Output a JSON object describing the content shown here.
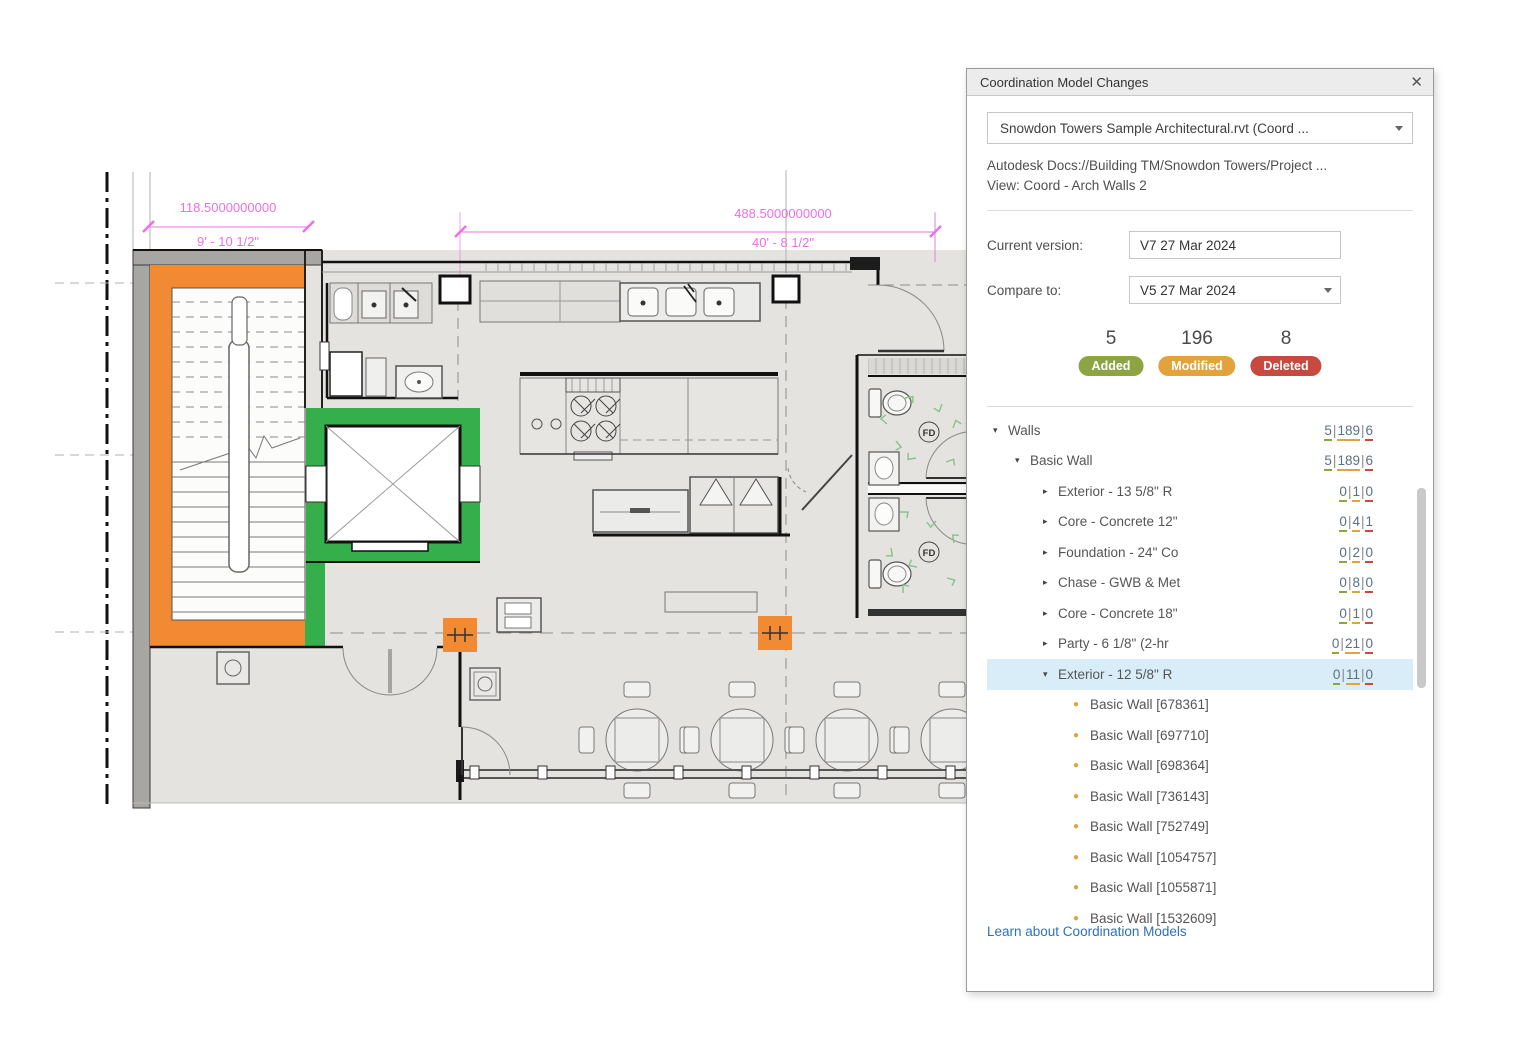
{
  "plan": {
    "dim1_top": "118.5000000000",
    "dim1_bottom": "9' - 10 1/2\"",
    "dim2_top": "488.5000000000",
    "dim2_bottom": "40' - 8 1/2\"",
    "fd_label": "FD",
    "colors": {
      "added_highlight": "#35AF4B",
      "modified_highlight": "#F18A33",
      "dimension_pink": "#ED6FE8"
    }
  },
  "panel": {
    "title": "Coordination Model Changes",
    "close_icon": "✕",
    "model_dropdown_value": "Snowdon Towers Sample Architectural.rvt (Coord ...",
    "source_line1": "Autodesk Docs://Building TM/Snowdon Towers/Project ...",
    "source_line2": "View: Coord - Arch Walls 2",
    "current_version_label": "Current version:",
    "current_version_value": "V7 27 Mar 2024",
    "compare_to_label": "Compare to:",
    "compare_to_value": "V5 27 Mar 2024",
    "stats": [
      {
        "count": "5",
        "label": "Added"
      },
      {
        "count": "196",
        "label": "Modified"
      },
      {
        "count": "8",
        "label": "Deleted"
      }
    ],
    "tree": [
      {
        "level": 1,
        "expanded": true,
        "selected": false,
        "label": "Walls",
        "counts": [
          "5",
          "189",
          "6"
        ]
      },
      {
        "level": 2,
        "expanded": true,
        "selected": false,
        "label": "Basic Wall",
        "counts": [
          "5",
          "189",
          "6"
        ]
      },
      {
        "level": 3,
        "expanded": false,
        "selected": false,
        "label": "Exterior - 13 5/8\" R",
        "counts": [
          "0",
          "1",
          "0"
        ]
      },
      {
        "level": 3,
        "expanded": false,
        "selected": false,
        "label": "Core - Concrete 12\"",
        "counts": [
          "0",
          "4",
          "1"
        ]
      },
      {
        "level": 3,
        "expanded": false,
        "selected": false,
        "label": "Foundation - 24\" Co",
        "counts": [
          "0",
          "2",
          "0"
        ]
      },
      {
        "level": 3,
        "expanded": false,
        "selected": false,
        "label": "Chase - GWB & Met",
        "counts": [
          "0",
          "8",
          "0"
        ]
      },
      {
        "level": 3,
        "expanded": false,
        "selected": false,
        "label": "Core - Concrete 18\"",
        "counts": [
          "0",
          "1",
          "0"
        ]
      },
      {
        "level": 3,
        "expanded": false,
        "selected": false,
        "label": "Party - 6 1/8\" (2-hr",
        "counts": [
          "0",
          "21",
          "0"
        ]
      },
      {
        "level": 3,
        "expanded": true,
        "selected": true,
        "label": "Exterior - 12 5/8\" R",
        "counts": [
          "0",
          "11",
          "0"
        ]
      }
    ],
    "leaves": [
      "Basic Wall [678361]",
      "Basic Wall [697710]",
      "Basic Wall [698364]",
      "Basic Wall [736143]",
      "Basic Wall [752749]",
      "Basic Wall [1054757]",
      "Basic Wall [1055871]",
      "Basic Wall [1532609]"
    ],
    "link": "Learn about Coordination Models"
  }
}
